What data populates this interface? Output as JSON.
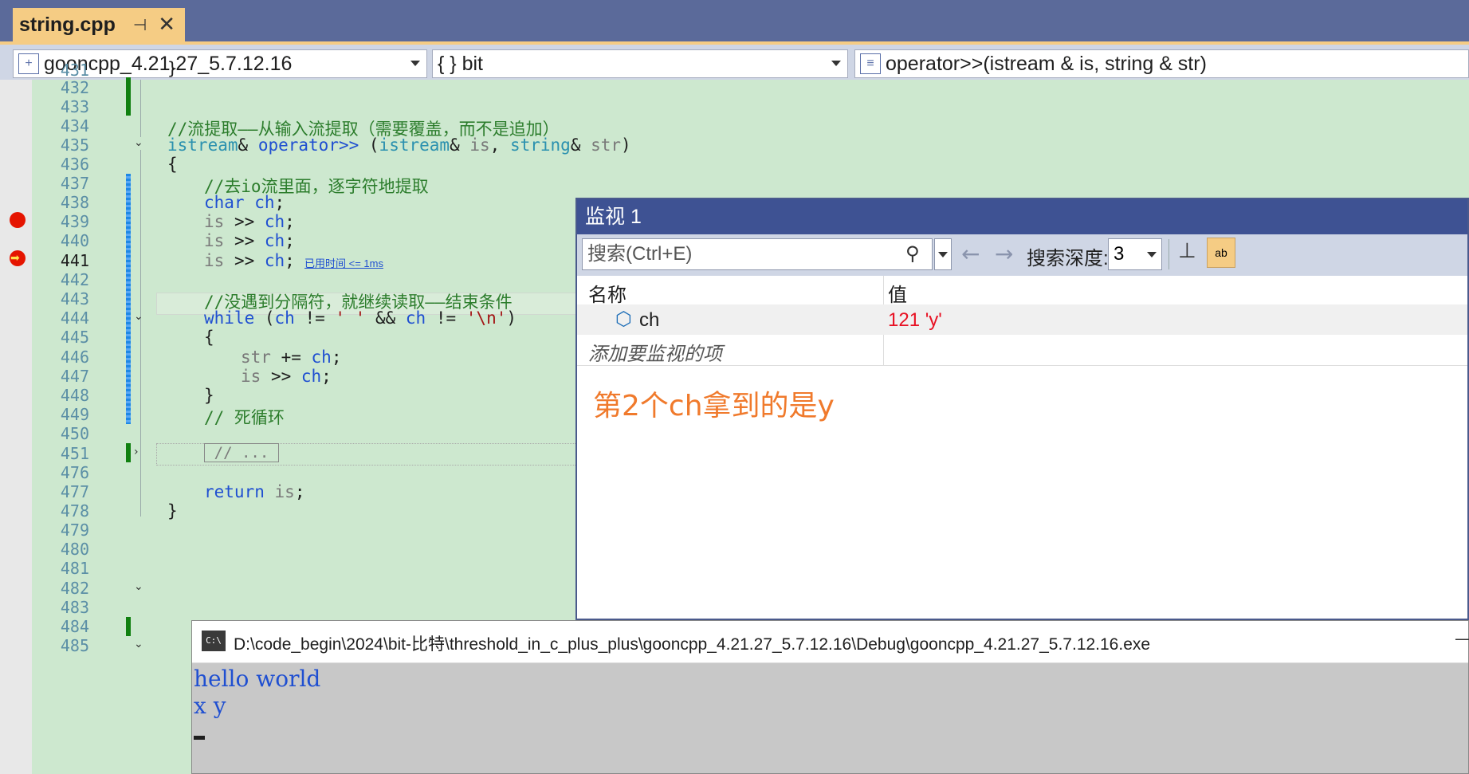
{
  "tab": {
    "name": "string.cpp",
    "pin_icon": "pin-icon",
    "close_icon": "close-icon"
  },
  "nav": {
    "project": "gooncpp_4.21.27_5.7.12.16",
    "scope": "{ } bit",
    "function": "operator>>(istream & is, string & str)"
  },
  "editor": {
    "line_numbers": [
      "431",
      "432",
      "433",
      "434",
      "435",
      "436",
      "437",
      "438",
      "439",
      "440",
      "441",
      "442",
      "443",
      "444",
      "445",
      "446",
      "447",
      "448",
      "449",
      "450",
      "451",
      "476",
      "477",
      "478",
      "479",
      "480",
      "481",
      "482",
      "483",
      "484",
      "485"
    ],
    "current_line": "441",
    "elapsed_hint": "已用时间 <= 1ms",
    "code": {
      "l431": "}",
      "l434": "//流提取——从输入流提取（需要覆盖，而不是追加）",
      "l435_ret_type": "istream",
      "l435_rest_a": "& ",
      "l435_op": "operator>>",
      "l435_rest_b": " (",
      "l435_p1_type": "istream",
      "l435_p1_amp": "& ",
      "l435_p1_name": "is",
      "l435_comma": ", ",
      "l435_p2_type": "string",
      "l435_p2_amp": "& ",
      "l435_p2_name": "str",
      "l435_close": ")",
      "l436": "{",
      "l437": "//去io流里面，逐字符地提取",
      "l438_kw": "char",
      "l438_var": " ch",
      "l438_semi": ";",
      "is_kw": "is",
      "extract_op": " >> ",
      "ch_var": "ch",
      "semi": ";",
      "l443": "//没遇到分隔符，就继续读取——结束条件",
      "l444_kw": "while",
      "l444_a": " (",
      "l444_b": " != ",
      "l444_c": "' '",
      "l444_d": " && ",
      "l444_e": " != ",
      "l444_f": "'\\n'",
      "l444_g": ")",
      "l445": "{",
      "l446_a": "str",
      "l446_b": " += ",
      "l448": "}",
      "l449": "// 死循环",
      "l451": "// ...",
      "l477_kw": "return",
      "l478": "}"
    }
  },
  "watch": {
    "title": "监视 1",
    "search_placeholder": "搜索(Ctrl+E)",
    "depth_label": "搜索深度:",
    "depth_value": "3",
    "col_name": "名称",
    "col_value": "值",
    "rows": [
      {
        "name": "ch",
        "value": "121 'y'"
      }
    ],
    "add_item_hint": "添加要监视的项",
    "annotation": "第2个ch拿到的是y"
  },
  "console": {
    "title": "D:\\code_begin\\2024\\bit-比特\\threshold_in_c_plus_plus\\gooncpp_4.21.27_5.7.12.16\\Debug\\gooncpp_4.21.27_5.7.12.16.exe",
    "icon_text": "C:\\",
    "lines": [
      "hello world",
      "x y"
    ],
    "minimize": "—"
  },
  "colors": {
    "tab_active": "#f5cc84",
    "editor_bg": "#cde8cf",
    "watch_title_bg": "#3e5293",
    "value_changed": "#e81123",
    "annotation": "#f07a2c"
  }
}
